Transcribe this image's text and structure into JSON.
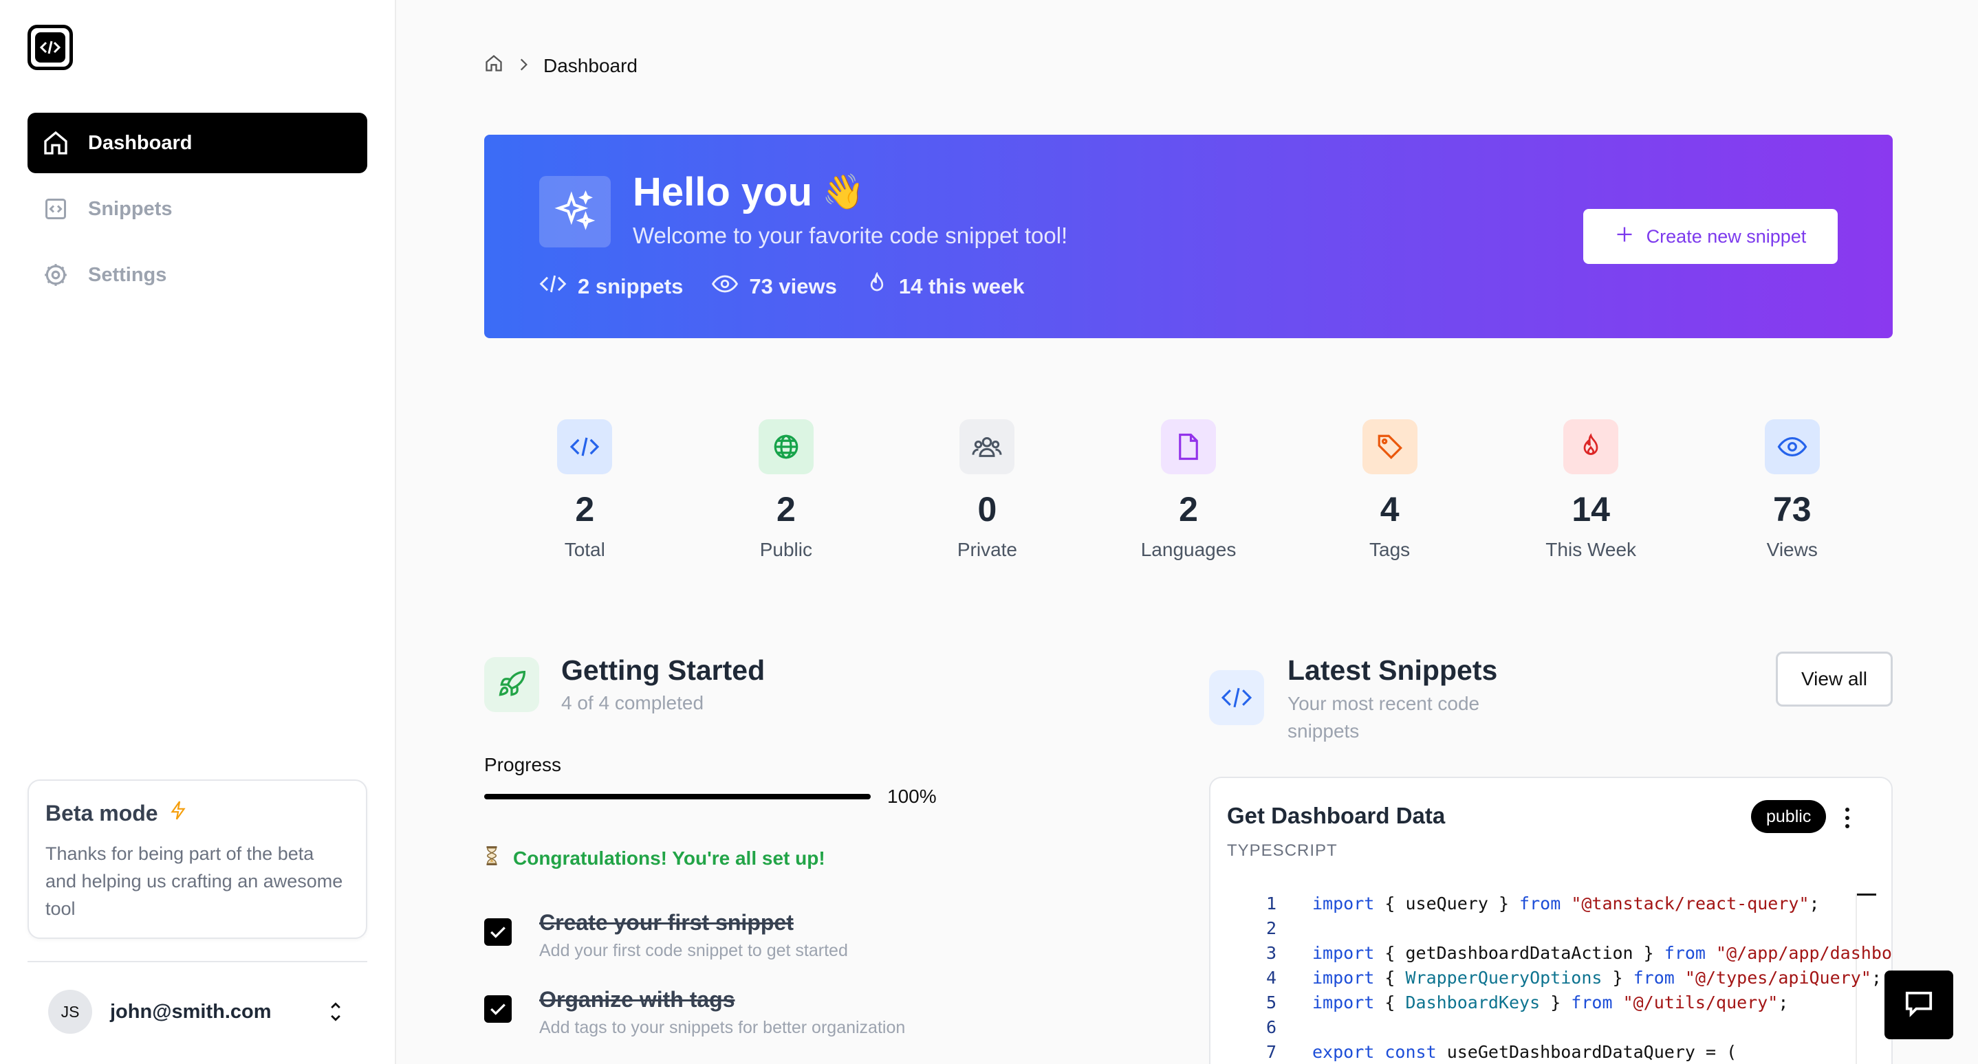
{
  "sidebar": {
    "items": [
      {
        "label": "Dashboard",
        "icon": "home-icon",
        "active": true
      },
      {
        "label": "Snippets",
        "icon": "code-square-icon",
        "active": false
      },
      {
        "label": "Settings",
        "icon": "gear-icon",
        "active": false
      }
    ],
    "beta": {
      "title": "Beta mode",
      "text": "Thanks for being part of the beta and helping us crafting an awesome tool"
    },
    "user": {
      "initials": "JS",
      "email": "john@smith.com"
    }
  },
  "breadcrumb": {
    "current": "Dashboard"
  },
  "hero": {
    "title": "Hello you",
    "emoji": "👋",
    "subtitle": "Welcome to your favorite code snippet tool!",
    "stats": {
      "snippets": "2 snippets",
      "views": "73 views",
      "week": "14 this week"
    },
    "button_label": "Create new snippet",
    "gradient_colors": [
      "#3b6cf6",
      "#8a39ef"
    ]
  },
  "stats": [
    {
      "value": "2",
      "label": "Total",
      "icon": "code-icon",
      "color": "#2563eb"
    },
    {
      "value": "2",
      "label": "Public",
      "icon": "globe-icon",
      "color": "#16a34a"
    },
    {
      "value": "0",
      "label": "Private",
      "icon": "users-icon",
      "color": "#4b5563"
    },
    {
      "value": "2",
      "label": "Languages",
      "icon": "file-icon",
      "color": "#9333ea"
    },
    {
      "value": "4",
      "label": "Tags",
      "icon": "tag-icon",
      "color": "#ea580c"
    },
    {
      "value": "14",
      "label": "This Week",
      "icon": "flame-icon",
      "color": "#dc2626"
    },
    {
      "value": "73",
      "label": "Views",
      "icon": "eye-icon",
      "color": "#2563eb"
    }
  ],
  "getting_started": {
    "title": "Getting Started",
    "subtitle": "4 of 4 completed",
    "progress_label": "Progress",
    "progress": 1.0,
    "progress_text": "100%",
    "congrats": "Congratulations! You're all set up!",
    "tasks": [
      {
        "title": "Create your first snippet",
        "subtitle": "Add your first code snippet to get started"
      },
      {
        "title": "Organize with tags",
        "subtitle": "Add tags to your snippets for better organization"
      }
    ]
  },
  "latest": {
    "title": "Latest Snippets",
    "subtitle": "Your most recent code snippets",
    "view_all": "View all",
    "card": {
      "title": "Get Dashboard Data",
      "language": "TYPESCRIPT",
      "badge": "public",
      "lines": [
        "1",
        "2",
        "3",
        "4",
        "5",
        "6",
        "7"
      ]
    }
  }
}
